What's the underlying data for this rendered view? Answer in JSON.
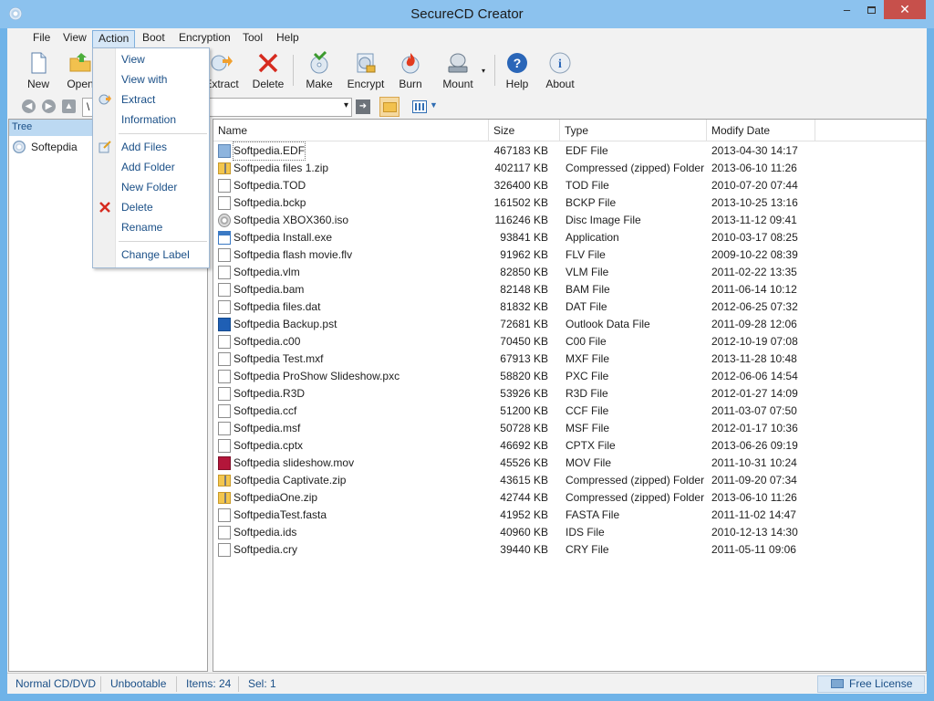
{
  "window": {
    "title": "SecureCD Creator",
    "minimize": "–",
    "close": "✕"
  },
  "menubar": [
    "File",
    "View",
    "Action",
    "Boot",
    "Encryption",
    "Tool",
    "Help"
  ],
  "toolbar": {
    "new": "New",
    "open": "Open",
    "extract": "Extract",
    "delete": "Delete",
    "make": "Make",
    "encrypt": "Encrypt",
    "burn": "Burn",
    "mount": "Mount",
    "help": "Help",
    "about": "About"
  },
  "address": {
    "value": "\\",
    "dropdown_arrow": "▾"
  },
  "tree": {
    "header": "Tree",
    "items": [
      "Softepdia"
    ]
  },
  "columns": [
    "Name",
    "Size",
    "Type",
    "Modify Date"
  ],
  "files": [
    {
      "name": "Softpedia.EDF",
      "size": "467183 KB",
      "type": "EDF File",
      "date": "2013-04-30 14:17",
      "icon": "edf-icon"
    },
    {
      "name": "Softpedia files 1.zip",
      "size": "402117 KB",
      "type": "Compressed (zipped) Folder",
      "date": "2013-06-10 11:26",
      "icon": "zip-folder-icon"
    },
    {
      "name": "Softpedia.TOD",
      "size": "326400 KB",
      "type": "TOD File",
      "date": "2010-07-20 07:44",
      "icon": "file-icon"
    },
    {
      "name": "Softpedia.bckp",
      "size": "161502 KB",
      "type": "BCKP File",
      "date": "2013-10-25 13:16",
      "icon": "file-icon"
    },
    {
      "name": "Softpedia XBOX360.iso",
      "size": "116246 KB",
      "type": "Disc Image File",
      "date": "2013-11-12 09:41",
      "icon": "disc-image-icon"
    },
    {
      "name": "Softpedia Install.exe",
      "size": "93841 KB",
      "type": "Application",
      "date": "2010-03-17 08:25",
      "icon": "application-icon"
    },
    {
      "name": "Softpedia flash movie.flv",
      "size": "91962 KB",
      "type": "FLV File",
      "date": "2009-10-22 08:39",
      "icon": "file-icon"
    },
    {
      "name": "Softpedia.vlm",
      "size": "82850 KB",
      "type": "VLM File",
      "date": "2011-02-22 13:35",
      "icon": "file-icon"
    },
    {
      "name": "Softpedia.bam",
      "size": "82148 KB",
      "type": "BAM File",
      "date": "2011-06-14 10:12",
      "icon": "file-icon"
    },
    {
      "name": "Softpedia files.dat",
      "size": "81832 KB",
      "type": "DAT File",
      "date": "2012-06-25 07:32",
      "icon": "file-icon"
    },
    {
      "name": "Softpedia Backup.pst",
      "size": "72681 KB",
      "type": "Outlook Data File",
      "date": "2011-09-28 12:06",
      "icon": "outlook-icon"
    },
    {
      "name": "Softpedia.c00",
      "size": "70450 KB",
      "type": "C00 File",
      "date": "2012-10-19 07:08",
      "icon": "file-icon"
    },
    {
      "name": "Softpedia Test.mxf",
      "size": "67913 KB",
      "type": "MXF File",
      "date": "2013-11-28 10:48",
      "icon": "file-icon"
    },
    {
      "name": "Softpedia ProShow Slideshow.pxc",
      "size": "58820 KB",
      "type": "PXC File",
      "date": "2012-06-06 14:54",
      "icon": "file-icon"
    },
    {
      "name": "Softpedia.R3D",
      "size": "53926 KB",
      "type": "R3D File",
      "date": "2012-01-27 14:09",
      "icon": "file-icon"
    },
    {
      "name": "Softpedia.ccf",
      "size": "51200 KB",
      "type": "CCF File",
      "date": "2011-03-07 07:50",
      "icon": "file-icon"
    },
    {
      "name": "Softpedia.msf",
      "size": "50728 KB",
      "type": "MSF File",
      "date": "2012-01-17 10:36",
      "icon": "file-icon"
    },
    {
      "name": "Softpedia.cptx",
      "size": "46692 KB",
      "type": "CPTX File",
      "date": "2013-06-26 09:19",
      "icon": "file-icon"
    },
    {
      "name": "Softpedia slideshow.mov",
      "size": "45526 KB",
      "type": "MOV File",
      "date": "2011-10-31 10:24",
      "icon": "movie-icon"
    },
    {
      "name": "Softpedia Captivate.zip",
      "size": "43615 KB",
      "type": "Compressed (zipped) Folder",
      "date": "2011-09-20 07:34",
      "icon": "zip-folder-icon"
    },
    {
      "name": "SoftpediaOne.zip",
      "size": "42744 KB",
      "type": "Compressed (zipped) Folder",
      "date": "2013-06-10 11:26",
      "icon": "zip-folder-icon"
    },
    {
      "name": "SoftpediaTest.fasta",
      "size": "41952 KB",
      "type": "FASTA File",
      "date": "2011-11-02 14:47",
      "icon": "file-icon"
    },
    {
      "name": "Softpedia.ids",
      "size": "40960 KB",
      "type": "IDS File",
      "date": "2010-12-13 14:30",
      "icon": "file-icon"
    },
    {
      "name": "Softpedia.cry",
      "size": "39440 KB",
      "type": "CRY File",
      "date": "2011-05-11 09:06",
      "icon": "file-icon"
    }
  ],
  "action_menu": {
    "view": "View",
    "view_with": "View with",
    "extract": "Extract",
    "information": "Information",
    "add_files": "Add Files",
    "add_folder": "Add Folder",
    "new_folder": "New Folder",
    "delete": "Delete",
    "rename": "Rename",
    "change_label": "Change Label"
  },
  "status": {
    "media": "Normal CD/DVD",
    "boot": "Unbootable",
    "items": "Items: 24",
    "selected": "Sel: 1",
    "license": "Free License"
  },
  "colors": {
    "accent": "#1a4f87",
    "title_bar": "#8cc2ee",
    "close_button": "#c7504b"
  }
}
